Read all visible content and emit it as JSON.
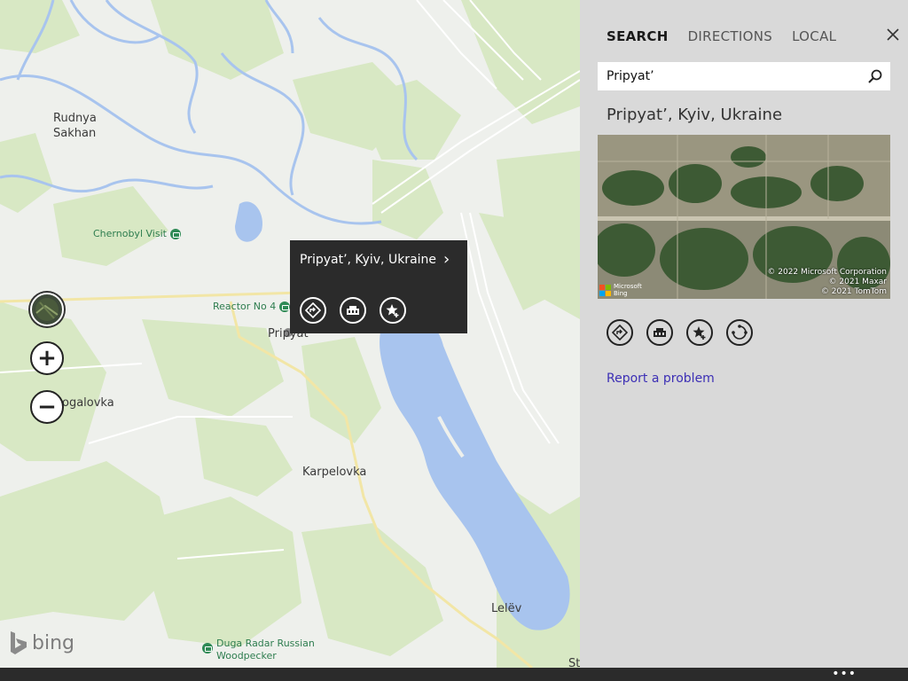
{
  "panel": {
    "tabs": [
      {
        "label": "SEARCH",
        "active": true
      },
      {
        "label": "DIRECTIONS",
        "active": false
      },
      {
        "label": "LOCAL",
        "active": false
      }
    ],
    "search_value": "Pripyat’",
    "result_title": "Pripyat’, Kyiv, Ukraine",
    "thumbnail": {
      "credit_lines": [
        "© 2022 Microsoft Corporation",
        "© 2021 Maxar",
        "© 2021 TomTom"
      ],
      "logo_text": [
        "Microsoft",
        "Bing"
      ]
    },
    "actions": [
      "directions-icon",
      "nearby-icon",
      "favorite-icon",
      "share-icon"
    ],
    "report_link": "Report a problem"
  },
  "map": {
    "labels": {
      "rudnya": "Rudnya",
      "sakhan": "Sakhan",
      "pripyat": "Pripyat",
      "ogalovka": "ogalovka",
      "karpelovka": "Karpelovka",
      "lelev": "Lelëv",
      "st": "St"
    },
    "pois": {
      "chernobyl": "Chernobyl Visit",
      "reactor": "Reactor No 4",
      "duga_line1": "Duga Radar Russian",
      "duga_line2": "Woodpecker"
    },
    "popup": {
      "title": "Pripyat’, Kyiv, Ukraine",
      "chevron": "›"
    },
    "controls": {
      "zoom_in": "+",
      "zoom_out": "−"
    },
    "brand": "bing"
  },
  "appbar": {
    "more": "•••"
  },
  "colors": {
    "land": "#eef0ec",
    "forest": "#d8e8c4",
    "water": "#a8c4ee",
    "road": "#f7e79c",
    "panel_bg": "#d9d9d9",
    "popup_bg": "#2b2b2b",
    "link": "#3c2fb5",
    "poi_green": "#2e7d4f"
  }
}
